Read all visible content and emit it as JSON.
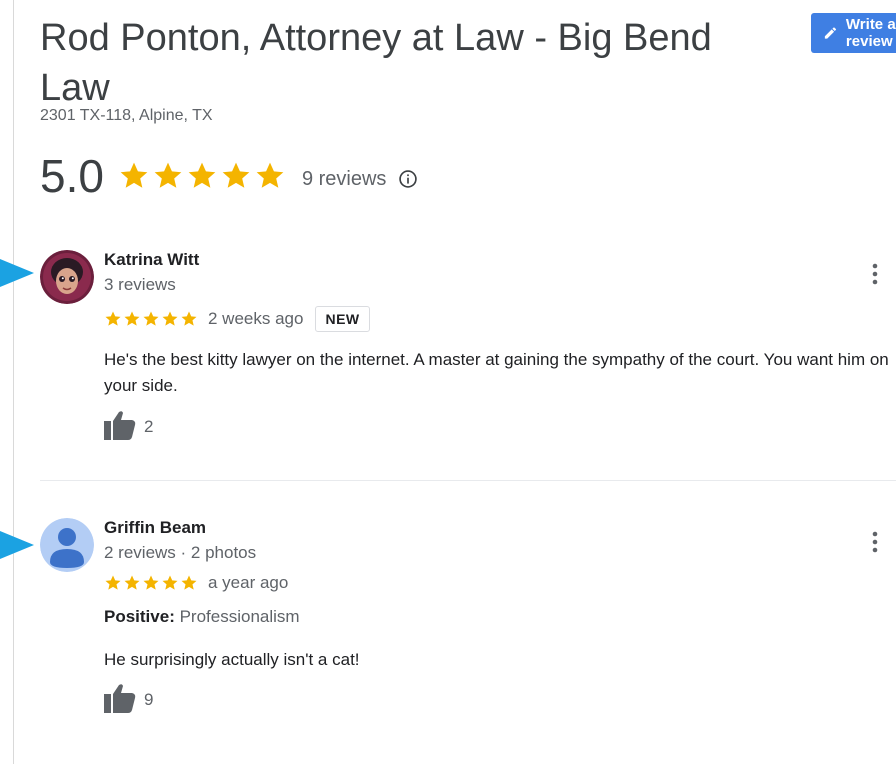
{
  "business": {
    "title": "Rod Ponton, Attorney at Law - Big Bend Law",
    "address": "2301 TX-118, Alpine, TX",
    "rating": "5.0",
    "reviews_label": "9 reviews",
    "star_color": "#f4b400"
  },
  "write_button": {
    "label": "Write a review",
    "color": "#3f7fe3"
  },
  "reviews": [
    {
      "name": "Katrina Witt",
      "meta": "3 reviews",
      "stars": 5,
      "time": "2 weeks ago",
      "badge": "NEW",
      "text": "He's the best kitty lawyer on the internet. A master at gaining the sympathy of the court. You want him on your side.",
      "likes": "2"
    },
    {
      "name": "Griffin Beam",
      "meta": "2 reviews · 2 photos",
      "stars": 5,
      "time": "a year ago",
      "positive_label": "Positive:",
      "positive_value": "Professionalism",
      "text": "He surprisingly actually isn't a cat!",
      "likes": "9"
    }
  ],
  "pointer_color": "#1ba2e2"
}
